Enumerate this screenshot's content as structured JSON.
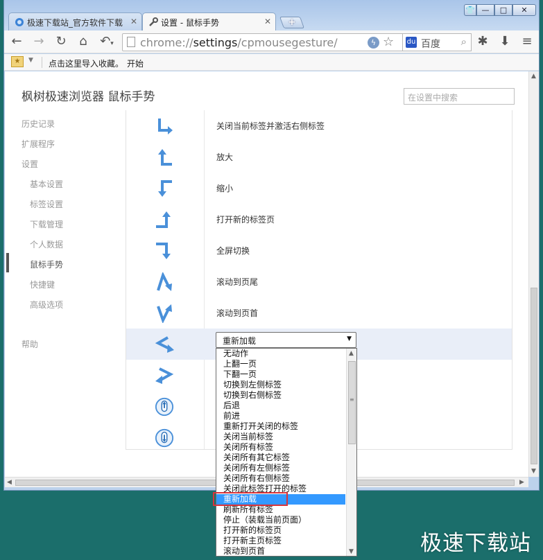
{
  "window": {
    "tabs": [
      {
        "label": "极速下载站_官方软件下载",
        "active": false
      },
      {
        "label": "设置 - 鼠标手势",
        "active": true
      }
    ],
    "new_tab_label": "+",
    "controls": {
      "minimize": "—",
      "maximize": "□",
      "close": "✕"
    }
  },
  "toolbar": {
    "url_scheme": "chrome://",
    "url_host": "settings",
    "url_path": "/cpmousegesture/",
    "search_engine": "百度"
  },
  "bookmarks": {
    "items": [
      "点击这里导入收藏。",
      "开始"
    ]
  },
  "page": {
    "title": "枫树极速浏览器 鼠标手势",
    "search_placeholder": "在设置中搜索"
  },
  "nav": {
    "items": [
      {
        "label": "历史记录",
        "level": 0
      },
      {
        "label": "扩展程序",
        "level": 0
      },
      {
        "label": "设置",
        "level": 0
      },
      {
        "label": "基本设置",
        "level": 1
      },
      {
        "label": "标签设置",
        "level": 1
      },
      {
        "label": "下载管理",
        "level": 1
      },
      {
        "label": "个人数据",
        "level": 1
      },
      {
        "label": "鼠标手势",
        "level": 1,
        "selected": true
      },
      {
        "label": "快捷键",
        "level": 1
      },
      {
        "label": "高级选项",
        "level": 1
      },
      {
        "label": "帮助",
        "level": 0
      }
    ]
  },
  "gestures": [
    {
      "icon": "gesture-down-right-icon",
      "action": "关闭当前标签并激活右侧标签"
    },
    {
      "icon": "gesture-up-left-icon",
      "action": "放大"
    },
    {
      "icon": "gesture-left-down-icon",
      "action": "缩小"
    },
    {
      "icon": "gesture-right-up-icon",
      "action": "打开新的标签页"
    },
    {
      "icon": "gesture-right-down-icon",
      "action": "全屏切换"
    },
    {
      "icon": "gesture-up-down-icon",
      "action": "滚动到页尾"
    },
    {
      "icon": "gesture-down-up-icon",
      "action": "滚动到页首"
    },
    {
      "icon": "gesture-left-right-icon",
      "action": "重新加载",
      "editing": true
    },
    {
      "icon": "gesture-right-left-icon",
      "action": ""
    },
    {
      "icon": "mouse-wheel-up-icon",
      "action": ""
    },
    {
      "icon": "mouse-wheel-down-icon",
      "action": ""
    }
  ],
  "dropdown": {
    "selected": "重新加载",
    "options": [
      "无动作",
      "上翻一页",
      "下翻一页",
      "切换到左侧标签",
      "切换到右侧标签",
      "后退",
      "前进",
      "重新打开关闭的标签",
      "关闭当前标签",
      "关闭所有标签",
      "关闭所有其它标签",
      "关闭所有左侧标签",
      "关闭所有右侧标签",
      "关闭此标签打开的标签",
      "重新加载",
      "刷新所有标签",
      "停止（装载当前页面）",
      "打开新的标签页",
      "打开新主页标签",
      "滚动到页首"
    ],
    "highlighted_index": 14
  },
  "watermark": "极速下载站",
  "colors": {
    "desktop": "#1b6e6b",
    "selection": "#3399ff",
    "gesture_blue": "#4a90d9",
    "highlight_border": "#d9343a"
  }
}
